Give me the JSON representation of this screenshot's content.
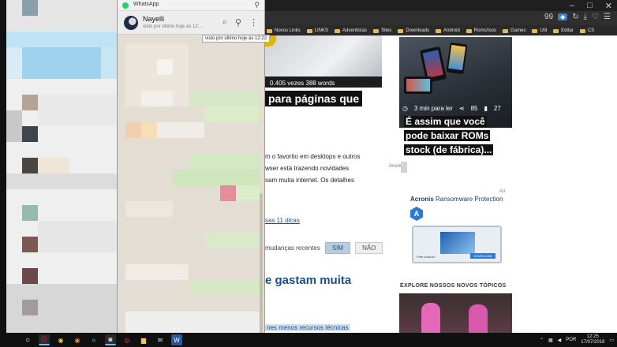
{
  "whatsapp": {
    "window_title": "WhatsApp",
    "contact_name": "Nayelli",
    "contact_status": "visto por último hoje às 12:...",
    "tooltip": "visto por último hoje às 12:22"
  },
  "browser": {
    "toolbar_badge": "99",
    "bookmarks": [
      "Novos Links",
      "LINKS",
      "Adventistas",
      "Sites",
      "Downloads",
      "Android",
      "Roms/Isos",
      "Games",
      "Util",
      "Editar",
      "CS"
    ],
    "article": {
      "hero_meta": "0.405 vezes   388 words",
      "headline_fragment": "para páginas que",
      "body_lines": [
        "m o favorito em desktops e outros",
        "wser está trazendo novidades",
        "sam muita internet. Os detalhes"
      ],
      "dicas_link": "sas 11 dicas",
      "mudancas_label": "mudanças recentes",
      "btn_sim": "SIM",
      "btn_nao": "NÃO",
      "gastam_heading": "e gastam muita",
      "bottom_link": "nes menos recursos técnicas"
    },
    "sidebar": {
      "read_time": "3 min para ler",
      "shares": "85",
      "comments": "27",
      "card_title": "É assim que você pode baixar ROMs stock (de fábrica)...",
      "anuncio": "Anúncio",
      "ad_label": "Ad",
      "ad_title_brand": "Acronis",
      "ad_title_rest": "Ransomware Protection",
      "ad_free": "Free product",
      "ad_download": "DOWNLOAD",
      "explore_heading": "EXPLORE NOSSOS NOVOS TÓPICOS"
    }
  },
  "taskbar": {
    "language": "POR",
    "time": "12:25",
    "date": "17/07/2018"
  },
  "colors": {
    "accent_blue": "#1a4f8b",
    "whatsapp_green": "#25d366",
    "taskbar": "#101010"
  }
}
